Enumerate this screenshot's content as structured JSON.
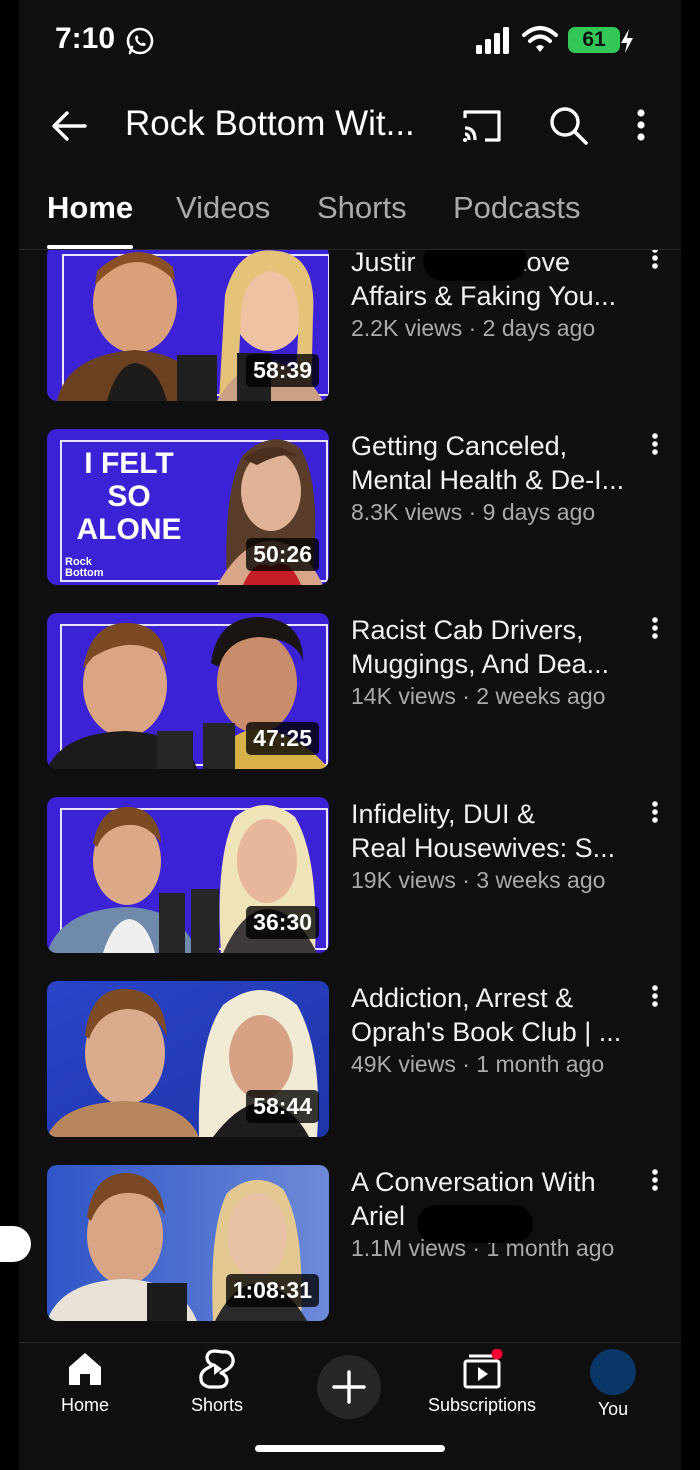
{
  "status_bar": {
    "time": "7:10",
    "battery": "61"
  },
  "header": {
    "title": "Rock Bottom Wit..."
  },
  "tabs": [
    {
      "label": "Home",
      "active": true
    },
    {
      "label": "Videos",
      "active": false
    },
    {
      "label": "Shorts",
      "active": false
    },
    {
      "label": "Podcasts",
      "active": false
    }
  ],
  "videos": [
    {
      "title_line1": "Justir",
      "title_line1b": "Love",
      "title_line2": "Affairs & Faking You...",
      "views": "2.2K views · 2 days ago",
      "duration": "58:39"
    },
    {
      "title_line1": "Getting Canceled,",
      "title_line2": "Mental Health & De-I...",
      "views": "8.3K views · 9 days ago",
      "duration": "50:26",
      "thumb_text": [
        "I FELT",
        "SO",
        "ALONE"
      ],
      "thumb_logo": [
        "Rock",
        "Bottom"
      ]
    },
    {
      "title_line1": "Racist Cab Drivers,",
      "title_line2": "Muggings, And Dea...",
      "views": "14K views · 2 weeks ago",
      "duration": "47:25"
    },
    {
      "title_line1": "Infidelity, DUI &",
      "title_line2": "Real Housewives: S...",
      "views": "19K views · 3 weeks ago",
      "duration": "36:30"
    },
    {
      "title_line1": "Addiction, Arrest &",
      "title_line2": "Oprah's Book Club | ...",
      "views": "49K views · 1 month ago",
      "duration": "58:44"
    },
    {
      "title_line1": "A Conversation With",
      "title_line2": "Ariel",
      "views": "1.1M views · 1 month ago",
      "duration": "1:08:31"
    }
  ],
  "bottom_nav": {
    "home": "Home",
    "shorts": "Shorts",
    "subscriptions": "Subscriptions",
    "you": "You"
  },
  "colors": {
    "background": "#0f0f0f",
    "thumb_purple": "#3b22d6",
    "battery_green": "#33c758",
    "notification_red": "#ff0033"
  },
  "icons": [
    "whatsapp-icon",
    "signal-icon",
    "wifi-icon",
    "battery-icon",
    "back-arrow-icon",
    "cast-icon",
    "search-icon",
    "more-vert-icon",
    "home-icon",
    "shorts-icon",
    "create-plus-icon",
    "subscriptions-icon"
  ]
}
